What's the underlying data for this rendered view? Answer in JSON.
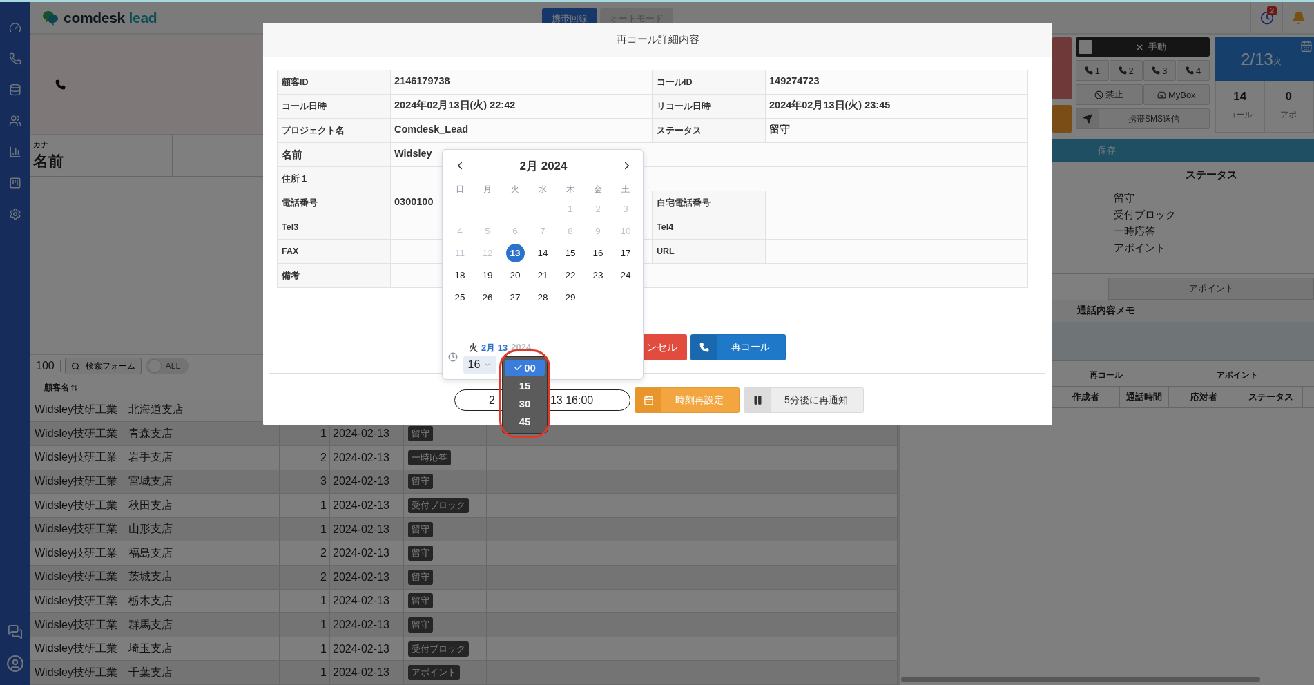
{
  "logo": {
    "text": "comdesk",
    "suffix": "lead"
  },
  "header": {
    "tabs": [
      {
        "label": "携帯回線",
        "selected": true
      },
      {
        "label": "オートモード",
        "selected": false
      }
    ],
    "notification_count": "2"
  },
  "left_panel": {
    "kana_label": "カナ",
    "name_label": "名前"
  },
  "customer_list": {
    "page_size": "100",
    "search_button": "検索フォーム",
    "toggle": {
      "label": "ALL",
      "on": false
    },
    "name_column": "顧客名",
    "rows": [
      {
        "name": "Widsley技研工業　北海道支店"
      },
      {
        "name": "Widsley技研工業　青森支店",
        "count": "1",
        "date": "2024-02-13",
        "status": "留守"
      },
      {
        "name": "Widsley技研工業　岩手支店",
        "count": "2",
        "date": "2024-02-13",
        "status": "一時応答"
      },
      {
        "name": "Widsley技研工業　宮城支店",
        "count": "3",
        "date": "2024-02-13",
        "status": "留守"
      },
      {
        "name": "Widsley技研工業　秋田支店",
        "count": "1",
        "date": "2024-02-13",
        "status": "受付ブロック"
      },
      {
        "name": "Widsley技研工業　山形支店",
        "count": "1",
        "date": "2024-02-13",
        "status": "留守"
      },
      {
        "name": "Widsley技研工業　福島支店",
        "count": "2",
        "date": "2024-02-13",
        "status": "留守"
      },
      {
        "name": "Widsley技研工業　茨城支店",
        "count": "2",
        "date": "2024-02-13",
        "status": "留守"
      },
      {
        "name": "Widsley技研工業　栃木支店",
        "count": "1",
        "date": "2024-02-13",
        "status": "留守"
      },
      {
        "name": "Widsley技研工業　群馬支店",
        "count": "1",
        "date": "2024-02-13",
        "status": "留守"
      },
      {
        "name": "Widsley技研工業　埼玉支店",
        "count": "1",
        "date": "2024-02-13",
        "status": "受付ブロック"
      },
      {
        "name": "Widsley技研工業　千葉支店",
        "count": "1",
        "date": "2024-02-13",
        "status": "アポイント"
      }
    ]
  },
  "right_panel": {
    "mode_bar": {
      "label": "手動",
      "checked": false
    },
    "line_buttons": [
      "1",
      "2",
      "3",
      "4"
    ],
    "block_button": "禁止",
    "mybox_button": "MyBox",
    "sms_button": "携帯SMS送信",
    "date": {
      "day": "2/13",
      "weekday": "火"
    },
    "stats": [
      {
        "value": "14",
        "label": "コール"
      },
      {
        "value": "0",
        "label": "アポ"
      }
    ],
    "save_button": "保存",
    "status_header": "ステータス",
    "statuses": [
      "留守",
      "受付ブロック",
      "一時応答",
      "アポイント"
    ],
    "appoint_button": "アポイント",
    "memo_label": "通話内容メモ",
    "history_tabs": [
      "再コール",
      "アポイント"
    ],
    "history_columns": [
      "作成者",
      "通話時間",
      "応対者",
      "ステータス"
    ]
  },
  "modal": {
    "title": "再コール詳細内容",
    "rows": [
      {
        "cells": [
          {
            "label": "顧客ID",
            "value": "2146179738"
          },
          {
            "label": "コールID",
            "value": "149274723"
          }
        ]
      },
      {
        "cells": [
          {
            "label": "コール日時",
            "value": "2024年02月13日(火) 22:42"
          },
          {
            "label": "リコール日時",
            "value": "2024年02月13日(火) 23:45"
          }
        ]
      },
      {
        "cells": [
          {
            "label": "プロジェクト名",
            "value": "Comdesk_Lead"
          },
          {
            "label": "ステータス",
            "value": "留守"
          }
        ]
      },
      {
        "cells": [
          {
            "label": "名前",
            "value": "Widsley"
          }
        ]
      },
      {
        "cells": [
          {
            "label": "住所１"
          }
        ]
      },
      {
        "cells": [
          {
            "label": "電話番号",
            "value": "0300100"
          },
          {
            "label": "自宅電話番号"
          }
        ]
      },
      {
        "cells": [
          {
            "label": "Tel3"
          },
          {
            "label": "Tel4"
          }
        ]
      },
      {
        "cells": [
          {
            "label": "FAX"
          },
          {
            "label": "URL"
          }
        ]
      },
      {
        "cells": [
          {
            "label": "備考"
          }
        ]
      }
    ],
    "cancel_button": "ンセル",
    "recall_button": "再コール",
    "datetime": [
      "2",
      "13 16:00"
    ],
    "reset_button": "時刻再設定",
    "snooze_button": "5分後に再通知"
  },
  "calendar": {
    "month_title": "2月 2024",
    "weekdays": [
      "日",
      "月",
      "火",
      "水",
      "木",
      "金",
      "土"
    ],
    "days": [
      {
        "kind": "blank"
      },
      {
        "kind": "blank"
      },
      {
        "kind": "blank"
      },
      {
        "kind": "blank"
      },
      {
        "kind": "day",
        "label": "1",
        "disabled": true,
        "selected": false
      },
      {
        "kind": "day",
        "label": "2",
        "disabled": true,
        "selected": false
      },
      {
        "kind": "day",
        "label": "3",
        "disabled": true,
        "selected": false
      },
      {
        "kind": "day",
        "label": "4",
        "disabled": true,
        "selected": false
      },
      {
        "kind": "day",
        "label": "5",
        "disabled": true,
        "selected": false
      },
      {
        "kind": "day",
        "label": "6",
        "disabled": true,
        "selected": false
      },
      {
        "kind": "day",
        "label": "7",
        "disabled": true,
        "selected": false
      },
      {
        "kind": "day",
        "label": "8",
        "disabled": true,
        "selected": false
      },
      {
        "kind": "day",
        "label": "9",
        "disabled": true,
        "selected": false
      },
      {
        "kind": "day",
        "label": "10",
        "disabled": true,
        "selected": false
      },
      {
        "kind": "day",
        "label": "11",
        "disabled": true,
        "selected": false
      },
      {
        "kind": "day",
        "label": "12",
        "disabled": true,
        "selected": false
      },
      {
        "kind": "day",
        "label": "13",
        "disabled": false,
        "selected": true
      },
      {
        "kind": "day",
        "label": "14",
        "disabled": false,
        "selected": false
      },
      {
        "kind": "day",
        "label": "15",
        "disabled": false,
        "selected": false
      },
      {
        "kind": "day",
        "label": "16",
        "disabled": false,
        "selected": false
      },
      {
        "kind": "day",
        "label": "17",
        "disabled": false,
        "selected": false
      },
      {
        "kind": "day",
        "label": "18",
        "disabled": false,
        "selected": false
      },
      {
        "kind": "day",
        "label": "19",
        "disabled": false,
        "selected": false
      },
      {
        "kind": "day",
        "label": "20",
        "disabled": false,
        "selected": false
      },
      {
        "kind": "day",
        "label": "21",
        "disabled": false,
        "selected": false
      },
      {
        "kind": "day",
        "label": "22",
        "disabled": false,
        "selected": false
      },
      {
        "kind": "day",
        "label": "23",
        "disabled": false,
        "selected": false
      },
      {
        "kind": "day",
        "label": "24",
        "disabled": false,
        "selected": false
      },
      {
        "kind": "day",
        "label": "25",
        "disabled": false,
        "selected": false
      },
      {
        "kind": "day",
        "label": "26",
        "disabled": false,
        "selected": false
      },
      {
        "kind": "day",
        "label": "27",
        "disabled": false,
        "selected": false
      },
      {
        "kind": "day",
        "label": "28",
        "disabled": false,
        "selected": false
      },
      {
        "kind": "day",
        "label": "29",
        "disabled": false,
        "selected": false
      }
    ],
    "footer": {
      "weekday": "火",
      "date": "2月 13",
      "year": "2024"
    },
    "hour": "16",
    "minute_options": [
      {
        "label": "00",
        "selected": true
      },
      {
        "label": "15",
        "selected": false
      },
      {
        "label": "30",
        "selected": false
      },
      {
        "label": "45",
        "selected": false
      }
    ]
  }
}
